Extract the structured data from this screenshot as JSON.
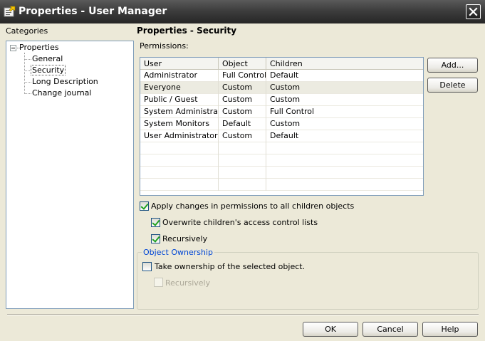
{
  "window": {
    "title": "Properties - User Manager"
  },
  "categories": {
    "label": "Categories",
    "tree": {
      "root": "Properties",
      "children": [
        "General",
        "Security",
        "Long Description",
        "Change journal"
      ]
    }
  },
  "section": {
    "title": "Properties - Security",
    "permissions_label": "Permissions:"
  },
  "table": {
    "columns": [
      "User",
      "Object",
      "Children"
    ],
    "rows": [
      [
        "Administrator",
        "Full Control",
        "Default"
      ],
      [
        "Everyone",
        "Custom",
        "Custom"
      ],
      [
        "Public / Guest",
        "Custom",
        "Custom"
      ],
      [
        "System Administrators",
        "Custom",
        "Full Control"
      ],
      [
        "System Monitors",
        "Default",
        "Custom"
      ],
      [
        "User Administrators",
        "Custom",
        "Default"
      ]
    ]
  },
  "side_buttons": {
    "add": "Add...",
    "delete": "Delete"
  },
  "options": {
    "apply_children": "Apply changes in permissions to all children objects",
    "overwrite_acl": "Overwrite children's access control lists",
    "recursively": "Recursively"
  },
  "ownership": {
    "group_title": "Object Ownership",
    "take_ownership": "Take ownership of the selected object.",
    "recursively": "Recursively"
  },
  "footer": {
    "ok": "OK",
    "cancel": "Cancel",
    "help": "Help"
  }
}
